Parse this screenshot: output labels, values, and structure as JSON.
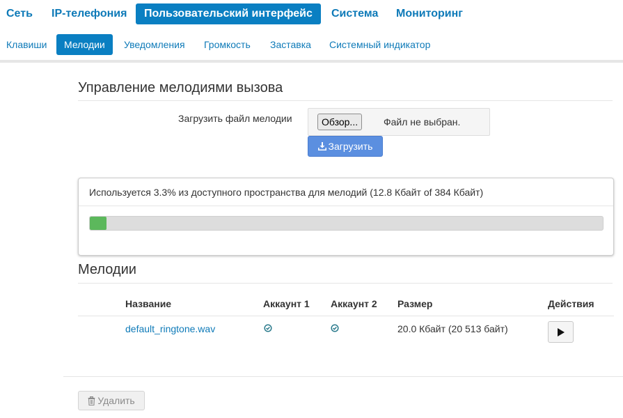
{
  "top_nav": {
    "items": [
      "Сеть",
      "IP-телефония",
      "Пользовательский интерфейс",
      "Система",
      "Мониторинг"
    ],
    "active_index": 2
  },
  "sub_nav": {
    "items": [
      "Клавиши",
      "Мелодии",
      "Уведомления",
      "Громкость",
      "Заставка",
      "Системный индикатор"
    ],
    "active_index": 1
  },
  "ringtone_management": {
    "title": "Управление мелодиями вызова",
    "upload_label": "Загрузить файл мелодии",
    "browse_label": "Обзор...",
    "file_status": "Файл не выбран.",
    "upload_button": "Загрузить",
    "upload_icon": "download-icon"
  },
  "storage": {
    "text": "Используется 3.3% из доступного пространства для мелодий (12.8 Кбайт of 384 Кбайт)",
    "used_percent": 3.3,
    "color": "#5cb85c"
  },
  "melodies": {
    "title": "Мелодии",
    "columns": [
      "Название",
      "Аккаунт 1",
      "Аккаунт 2",
      "Размер",
      "Действия"
    ],
    "rows": [
      {
        "name": "default_ringtone.wav",
        "account1": true,
        "account2": true,
        "size": "20.0 Кбайт (20 513 байт)",
        "action_icon": "play-icon"
      }
    ]
  },
  "delete_button": {
    "label": "Удалить",
    "icon": "trash-icon"
  },
  "colors": {
    "accent": "#0a7fc2",
    "link": "#0e7ab8",
    "upload_button": "#5b8fe0",
    "check": "#2a7a8c"
  }
}
